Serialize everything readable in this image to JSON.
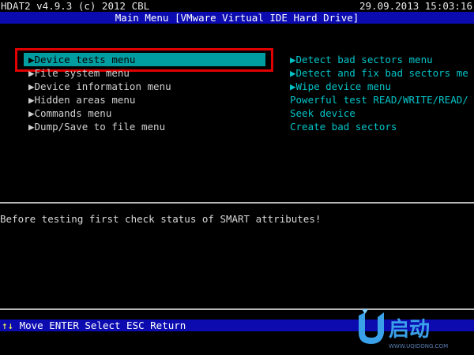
{
  "title_bar": {
    "app": "HDAT2 v4.9.3 (c) 2012 CBL",
    "datetime": "29.09.2013 15:03:16"
  },
  "header": {
    "text": "Main Menu [VMware Virtual IDE Hard Drive]"
  },
  "menu": {
    "items": [
      {
        "label": "▶Device tests menu",
        "selected": true
      },
      {
        "label": "▶File system menu"
      },
      {
        "label": "▶Device information menu"
      },
      {
        "label": "▶Hidden areas menu"
      },
      {
        "label": "▶Commands menu"
      },
      {
        "label": "▶Dump/Save to file menu"
      }
    ]
  },
  "submenu": {
    "items": [
      {
        "label": "▶Detect bad sectors menu"
      },
      {
        "label": "▶Detect and fix bad sectors me"
      },
      {
        "label": "▶Wipe device menu"
      },
      {
        "label": "Powerful test READ/WRITE/READ/"
      },
      {
        "label": "Seek device"
      },
      {
        "label": "Create bad sectors"
      }
    ]
  },
  "status": {
    "text": "Before testing first check status of SMART attributes!"
  },
  "footer": {
    "arrows": "↑↓",
    "text": "Move ENTER Select ESC Return"
  },
  "logo": {
    "text": "启动",
    "url_text": "WWW.UQIDONG.COM"
  },
  "colors": {
    "header_bg": "#0b0bb0",
    "selection_bg": "#009da0",
    "highlight_border": "#e10000",
    "submenu_text": "#00c4c8",
    "footer_keys": "#ffff55"
  }
}
